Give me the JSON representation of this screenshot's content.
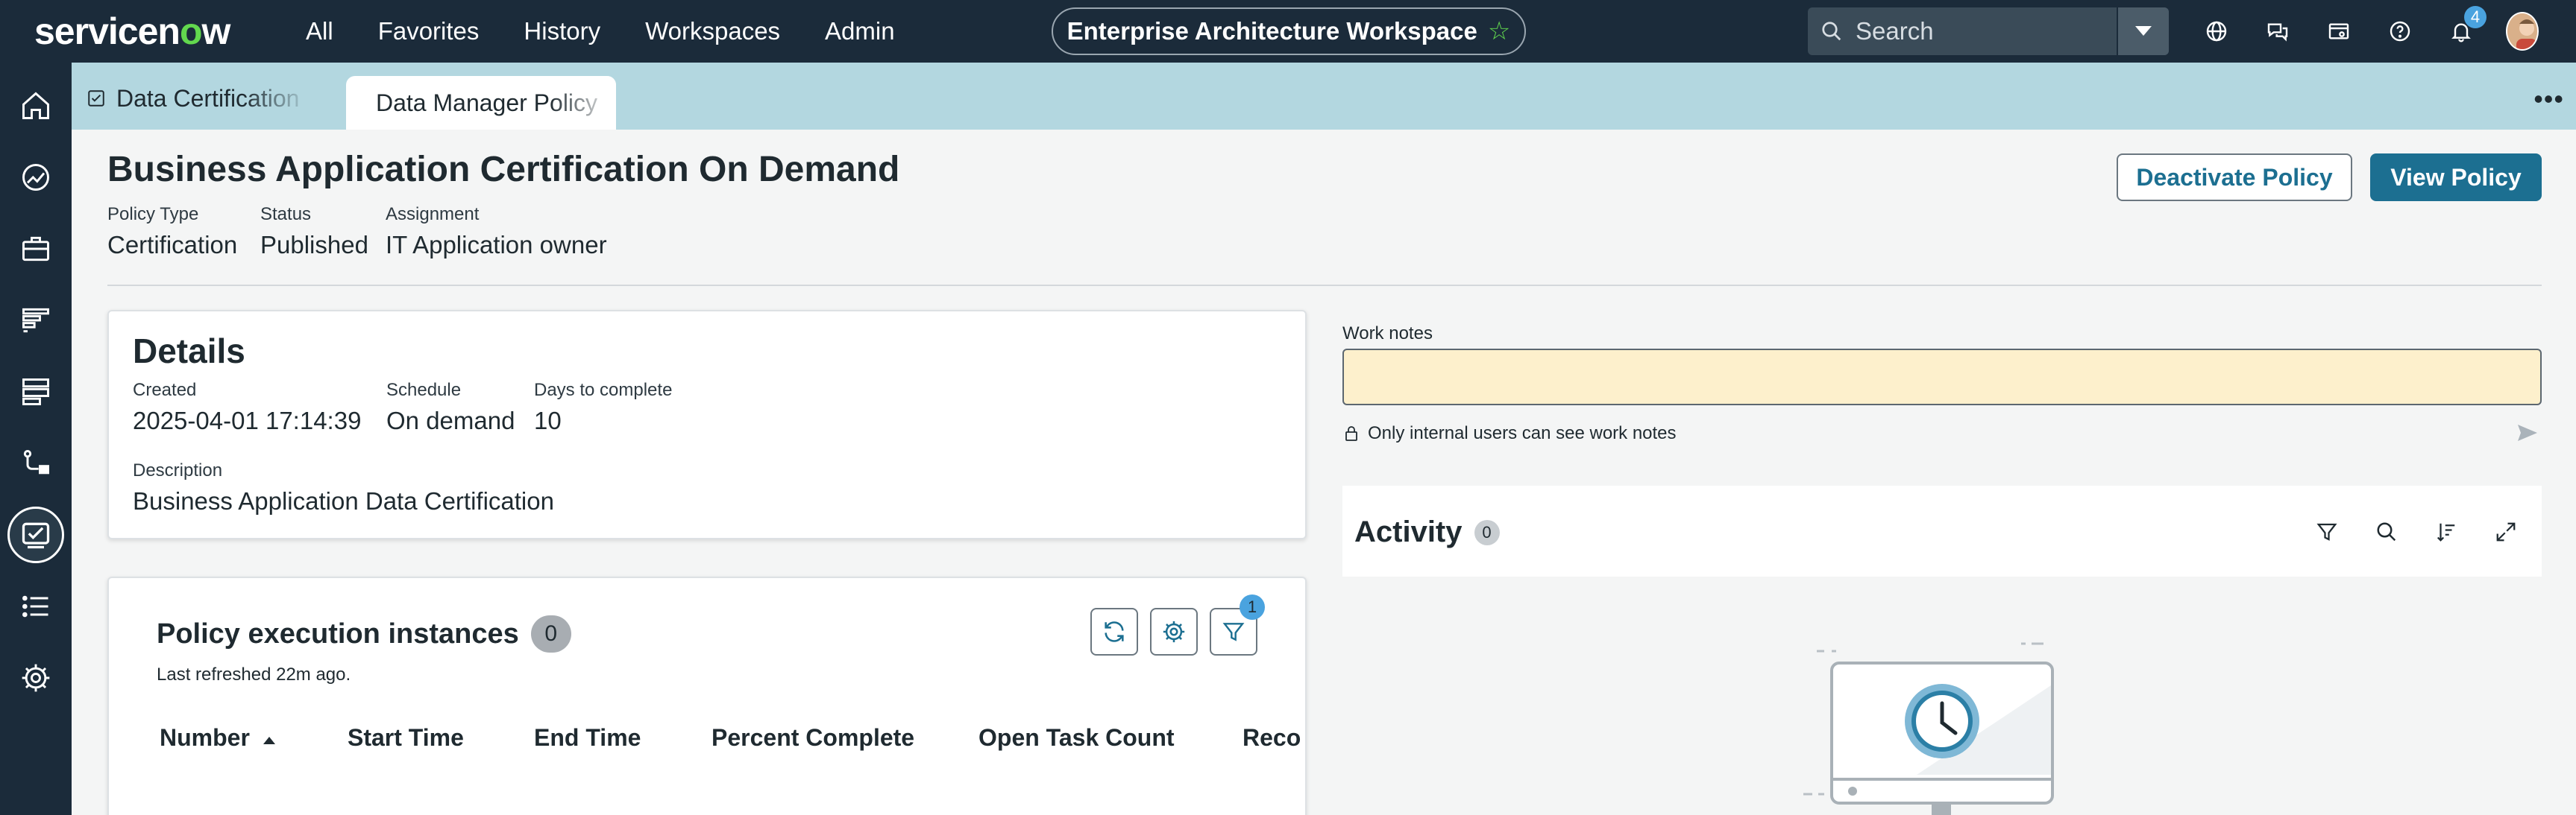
{
  "topnav": {
    "logo_text_a": "servicen",
    "logo_text_o": "o",
    "logo_text_b": "w",
    "menu": [
      "All",
      "Favorites",
      "History",
      "Workspaces",
      "Admin"
    ],
    "workspace": "Enterprise Architecture Workspace",
    "search_placeholder": "Search",
    "notification_count": "4",
    "icons": [
      "globe-icon",
      "chat-icon",
      "card-icon",
      "help-icon",
      "bell-icon",
      "avatar"
    ]
  },
  "rail": {
    "icons": [
      "home-icon",
      "dashboard-icon",
      "briefcase-icon",
      "chart-list-icon",
      "database-icon",
      "workflow-icon",
      "certification-icon",
      "list-icon",
      "gear-icon"
    ],
    "active": "certification-icon"
  },
  "tabs": [
    {
      "label": "Data Certification"
    },
    {
      "label": "Data Manager Policy"
    }
  ],
  "header": {
    "title": "Business Application Certification On Demand",
    "policy_type_label": "Policy Type",
    "policy_type": "Certification",
    "status_label": "Status",
    "status": "Published",
    "assignment_label": "Assignment",
    "assignment": "IT Application owner",
    "deactivate_label": "Deactivate Policy",
    "view_label": "View Policy"
  },
  "details": {
    "title": "Details",
    "created_label": "Created",
    "created": "2025-04-01 17:14:39",
    "schedule_label": "Schedule",
    "schedule": "On demand",
    "days_label": "Days to complete",
    "days": "10",
    "description_label": "Description",
    "description": "Business Application Data Certification"
  },
  "executions": {
    "title": "Policy execution instances",
    "count": "0",
    "refreshed": "Last refreshed 22m ago.",
    "filter_count": "1",
    "columns": [
      "Number",
      "Start Time",
      "End Time",
      "Percent Complete",
      "Open Task Count",
      "Reco"
    ]
  },
  "worknotes": {
    "label": "Work notes",
    "note": "Only internal users can see work notes"
  },
  "activity": {
    "title": "Activity",
    "count": "0"
  },
  "colors": {
    "nav_bg": "#1b2b3a",
    "tabbar_bg": "#b3d7e0",
    "primary": "#1c6f91",
    "brand_green": "#62d84e",
    "worknote_bg": "#fdf0cc"
  }
}
